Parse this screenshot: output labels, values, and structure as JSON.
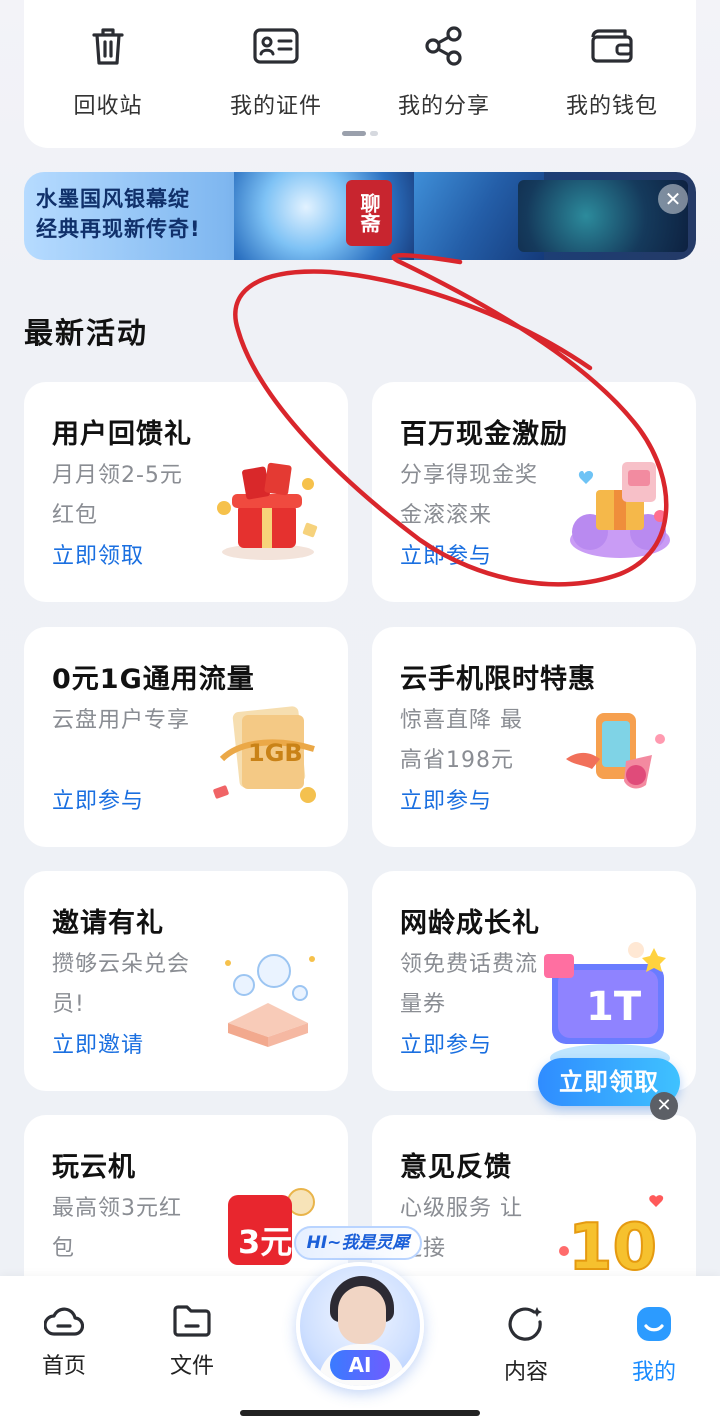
{
  "quick_actions": [
    {
      "label": "回收站",
      "icon": "trash-icon"
    },
    {
      "label": "我的证件",
      "icon": "id-card-icon"
    },
    {
      "label": "我的分享",
      "icon": "share-icon"
    },
    {
      "label": "我的钱包",
      "icon": "wallet-icon"
    }
  ],
  "banner": {
    "line1": "水墨国风银幕绽",
    "line2": "经典再现新传奇!",
    "seal_text": "聊斋"
  },
  "section_title": "最新活动",
  "activities": [
    {
      "title": "用户回馈礼",
      "desc": "月月领2-5元红包",
      "cta": "立即领取"
    },
    {
      "title": "百万现金激励",
      "desc": "分享得现金奖金滚滚来",
      "cta": "立即参与"
    },
    {
      "title": "0元1G通用流量",
      "desc": "云盘用户专享",
      "cta": "立即参与",
      "art_text": "1GB"
    },
    {
      "title": "云手机限时特惠",
      "desc": "惊喜直降 最高省198元",
      "cta": "立即参与"
    },
    {
      "title": "邀请有礼",
      "desc": "攒够云朵兑会员!",
      "cta": "立即邀请"
    },
    {
      "title": "网龄成长礼",
      "desc": "领免费话费流量券",
      "cta": "立即参与"
    },
    {
      "title": "玩云机",
      "desc": "最高领3元红包",
      "cta": "",
      "art_text": "3元"
    },
    {
      "title": "意见反馈",
      "desc": "心级服务 让连接",
      "cta": "",
      "art_text": "10"
    }
  ],
  "float_promo": {
    "button": "立即领取",
    "badge": "1T"
  },
  "ai_assistant": {
    "bubble": "HI~我是灵犀",
    "label": "AI"
  },
  "bottom_nav": [
    {
      "label": "首页",
      "icon": "cloud-home-icon",
      "active": false
    },
    {
      "label": "文件",
      "icon": "folder-icon",
      "active": false
    },
    {
      "label": "内容",
      "icon": "content-refresh-icon",
      "active": false
    },
    {
      "label": "我的",
      "icon": "profile-icon",
      "active": true
    }
  ],
  "colors": {
    "accent": "#1a6fe0",
    "active_tab": "#1a8cff",
    "annotation": "#d9262c"
  }
}
